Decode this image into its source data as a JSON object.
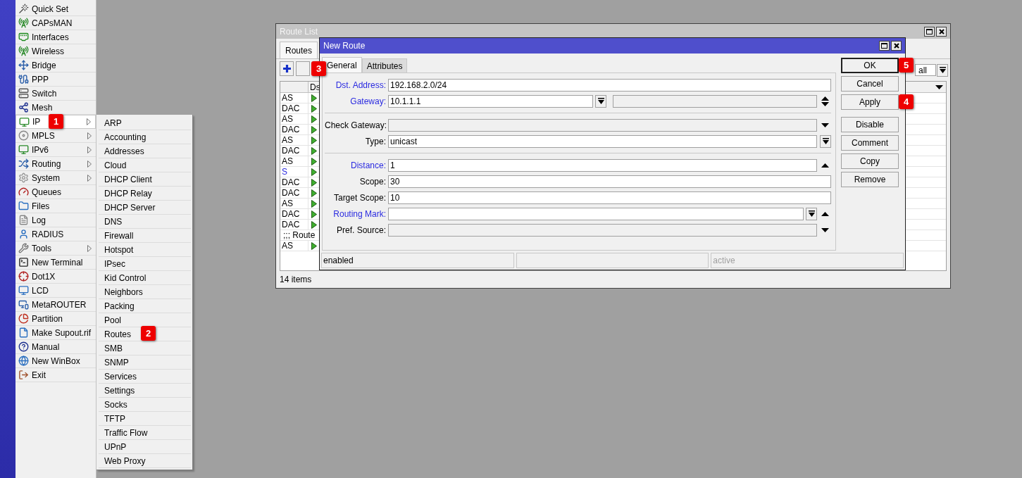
{
  "main_menu": {
    "items": [
      {
        "label": "Quick Set",
        "submenu": false,
        "selected": false
      },
      {
        "label": "CAPsMAN",
        "submenu": false,
        "selected": false
      },
      {
        "label": "Interfaces",
        "submenu": false,
        "selected": false
      },
      {
        "label": "Wireless",
        "submenu": false,
        "selected": false
      },
      {
        "label": "Bridge",
        "submenu": false,
        "selected": false
      },
      {
        "label": "PPP",
        "submenu": false,
        "selected": false
      },
      {
        "label": "Switch",
        "submenu": false,
        "selected": false
      },
      {
        "label": "Mesh",
        "submenu": false,
        "selected": false
      },
      {
        "label": "IP",
        "submenu": true,
        "selected": true,
        "badge": "1"
      },
      {
        "label": "MPLS",
        "submenu": true,
        "selected": false
      },
      {
        "label": "IPv6",
        "submenu": true,
        "selected": false
      },
      {
        "label": "Routing",
        "submenu": true,
        "selected": false
      },
      {
        "label": "System",
        "submenu": true,
        "selected": false
      },
      {
        "label": "Queues",
        "submenu": false,
        "selected": false
      },
      {
        "label": "Files",
        "submenu": false,
        "selected": false
      },
      {
        "label": "Log",
        "submenu": false,
        "selected": false
      },
      {
        "label": "RADIUS",
        "submenu": false,
        "selected": false
      },
      {
        "label": "Tools",
        "submenu": true,
        "selected": false
      },
      {
        "label": "New Terminal",
        "submenu": false,
        "selected": false
      },
      {
        "label": "Dot1X",
        "submenu": false,
        "selected": false
      },
      {
        "label": "LCD",
        "submenu": false,
        "selected": false
      },
      {
        "label": "MetaROUTER",
        "submenu": false,
        "selected": false
      },
      {
        "label": "Partition",
        "submenu": false,
        "selected": false
      },
      {
        "label": "Make Supout.rif",
        "submenu": false,
        "selected": false
      },
      {
        "label": "Manual",
        "submenu": false,
        "selected": false
      },
      {
        "label": "New WinBox",
        "submenu": false,
        "selected": false
      },
      {
        "label": "Exit",
        "submenu": false,
        "selected": false
      }
    ]
  },
  "ip_submenu": {
    "items": [
      {
        "label": "ARP"
      },
      {
        "label": "Accounting"
      },
      {
        "label": "Addresses"
      },
      {
        "label": "Cloud"
      },
      {
        "label": "DHCP Client"
      },
      {
        "label": "DHCP Relay"
      },
      {
        "label": "DHCP Server"
      },
      {
        "label": "DNS"
      },
      {
        "label": "Firewall"
      },
      {
        "label": "Hotspot"
      },
      {
        "label": "IPsec"
      },
      {
        "label": "Kid Control"
      },
      {
        "label": "Neighbors"
      },
      {
        "label": "Packing"
      },
      {
        "label": "Pool"
      },
      {
        "label": "Routes",
        "badge": "2"
      },
      {
        "label": "SMB"
      },
      {
        "label": "SNMP"
      },
      {
        "label": "Services"
      },
      {
        "label": "Settings"
      },
      {
        "label": "Socks"
      },
      {
        "label": "TFTP"
      },
      {
        "label": "Traffic Flow"
      },
      {
        "label": "UPnP"
      },
      {
        "label": "Web Proxy"
      }
    ]
  },
  "route_list": {
    "title": "Route List",
    "tabs": [
      {
        "label": "Routes",
        "selected": true
      }
    ],
    "toolbar": {
      "badge": "3",
      "filter": "all"
    },
    "columns": [
      "Ds"
    ],
    "rows": [
      {
        "kind": "route",
        "type": "AS",
        "color": "#000000"
      },
      {
        "kind": "route",
        "type": "DAC",
        "color": "#000000"
      },
      {
        "kind": "route",
        "type": "AS",
        "color": "#000000"
      },
      {
        "kind": "route",
        "type": "DAC",
        "color": "#000000"
      },
      {
        "kind": "route",
        "type": "AS",
        "color": "#000000"
      },
      {
        "kind": "route",
        "type": "DAC",
        "color": "#000000"
      },
      {
        "kind": "route",
        "type": "AS",
        "color": "#000000"
      },
      {
        "kind": "route",
        "type": "S",
        "color": "#2a2ae0"
      },
      {
        "kind": "route",
        "type": "DAC",
        "color": "#000000"
      },
      {
        "kind": "route",
        "type": "DAC",
        "color": "#000000"
      },
      {
        "kind": "route",
        "type": "AS",
        "color": "#000000"
      },
      {
        "kind": "route",
        "type": "DAC",
        "color": "#000000"
      },
      {
        "kind": "route",
        "type": "DAC",
        "color": "#000000"
      },
      {
        "kind": "comment",
        "text": ";;; Route"
      },
      {
        "kind": "route",
        "type": "AS",
        "color": "#000000"
      }
    ],
    "status": "14 items"
  },
  "new_route": {
    "title": "New Route",
    "tabs": [
      {
        "label": "General",
        "selected": true
      },
      {
        "label": "Attributes",
        "selected": false
      }
    ],
    "groups": [
      [
        {
          "kind": "plain",
          "label": "Dst. Address:",
          "color": "#2a2ae0",
          "value": "192.168.2.0/24",
          "disabled": false,
          "dropdown": false,
          "second_field": false
        },
        {
          "kind": "updown",
          "label": "Gateway:",
          "color": "#2a2ae0",
          "value": "10.1.1.1",
          "disabled": false,
          "dropdown": true,
          "second_field": true
        }
      ],
      [
        {
          "kind": "down",
          "label": "Check Gateway:",
          "color": "#000000",
          "disabled": true,
          "dropdown": false,
          "second_field": false
        },
        {
          "kind": "dropdown",
          "label": "Type:",
          "color": "#000000",
          "value": "unicast",
          "disabled": false,
          "dropdown": false,
          "second_field": false
        }
      ],
      [
        {
          "kind": "up",
          "label": "Distance:",
          "color": "#2a2ae0",
          "value": "1",
          "disabled": false,
          "dropdown": false,
          "second_field": false
        },
        {
          "kind": "plain",
          "label": "Scope:",
          "color": "#000000",
          "value": "30",
          "disabled": false,
          "dropdown": false,
          "second_field": false
        },
        {
          "kind": "plain",
          "label": "Target Scope:",
          "color": "#000000",
          "value": "10",
          "disabled": false,
          "dropdown": false,
          "second_field": false
        },
        {
          "kind": "up",
          "label": "Routing Mark:",
          "color": "#2a2ae0",
          "disabled": false,
          "dropdown": true,
          "second_field": false
        },
        {
          "kind": "down",
          "label": "Pref. Source:",
          "color": "#000000",
          "disabled": true,
          "dropdown": false,
          "second_field": false
        }
      ]
    ],
    "button_groups": [
      [
        {
          "label": "OK",
          "default": true,
          "badge": "5"
        },
        {
          "label": "Cancel",
          "default": false
        },
        {
          "label": "Apply",
          "default": false,
          "badge": "4"
        }
      ],
      [
        {
          "label": "Disable",
          "default": false
        },
        {
          "label": "Comment",
          "default": false
        },
        {
          "label": "Copy",
          "default": false
        },
        {
          "label": "Remove",
          "default": false
        }
      ]
    ],
    "status": [
      {
        "kind": "text",
        "text": "enabled",
        "disabled": false
      },
      {
        "kind": "blank"
      },
      {
        "kind": "text",
        "text": "active",
        "disabled": true
      }
    ]
  }
}
